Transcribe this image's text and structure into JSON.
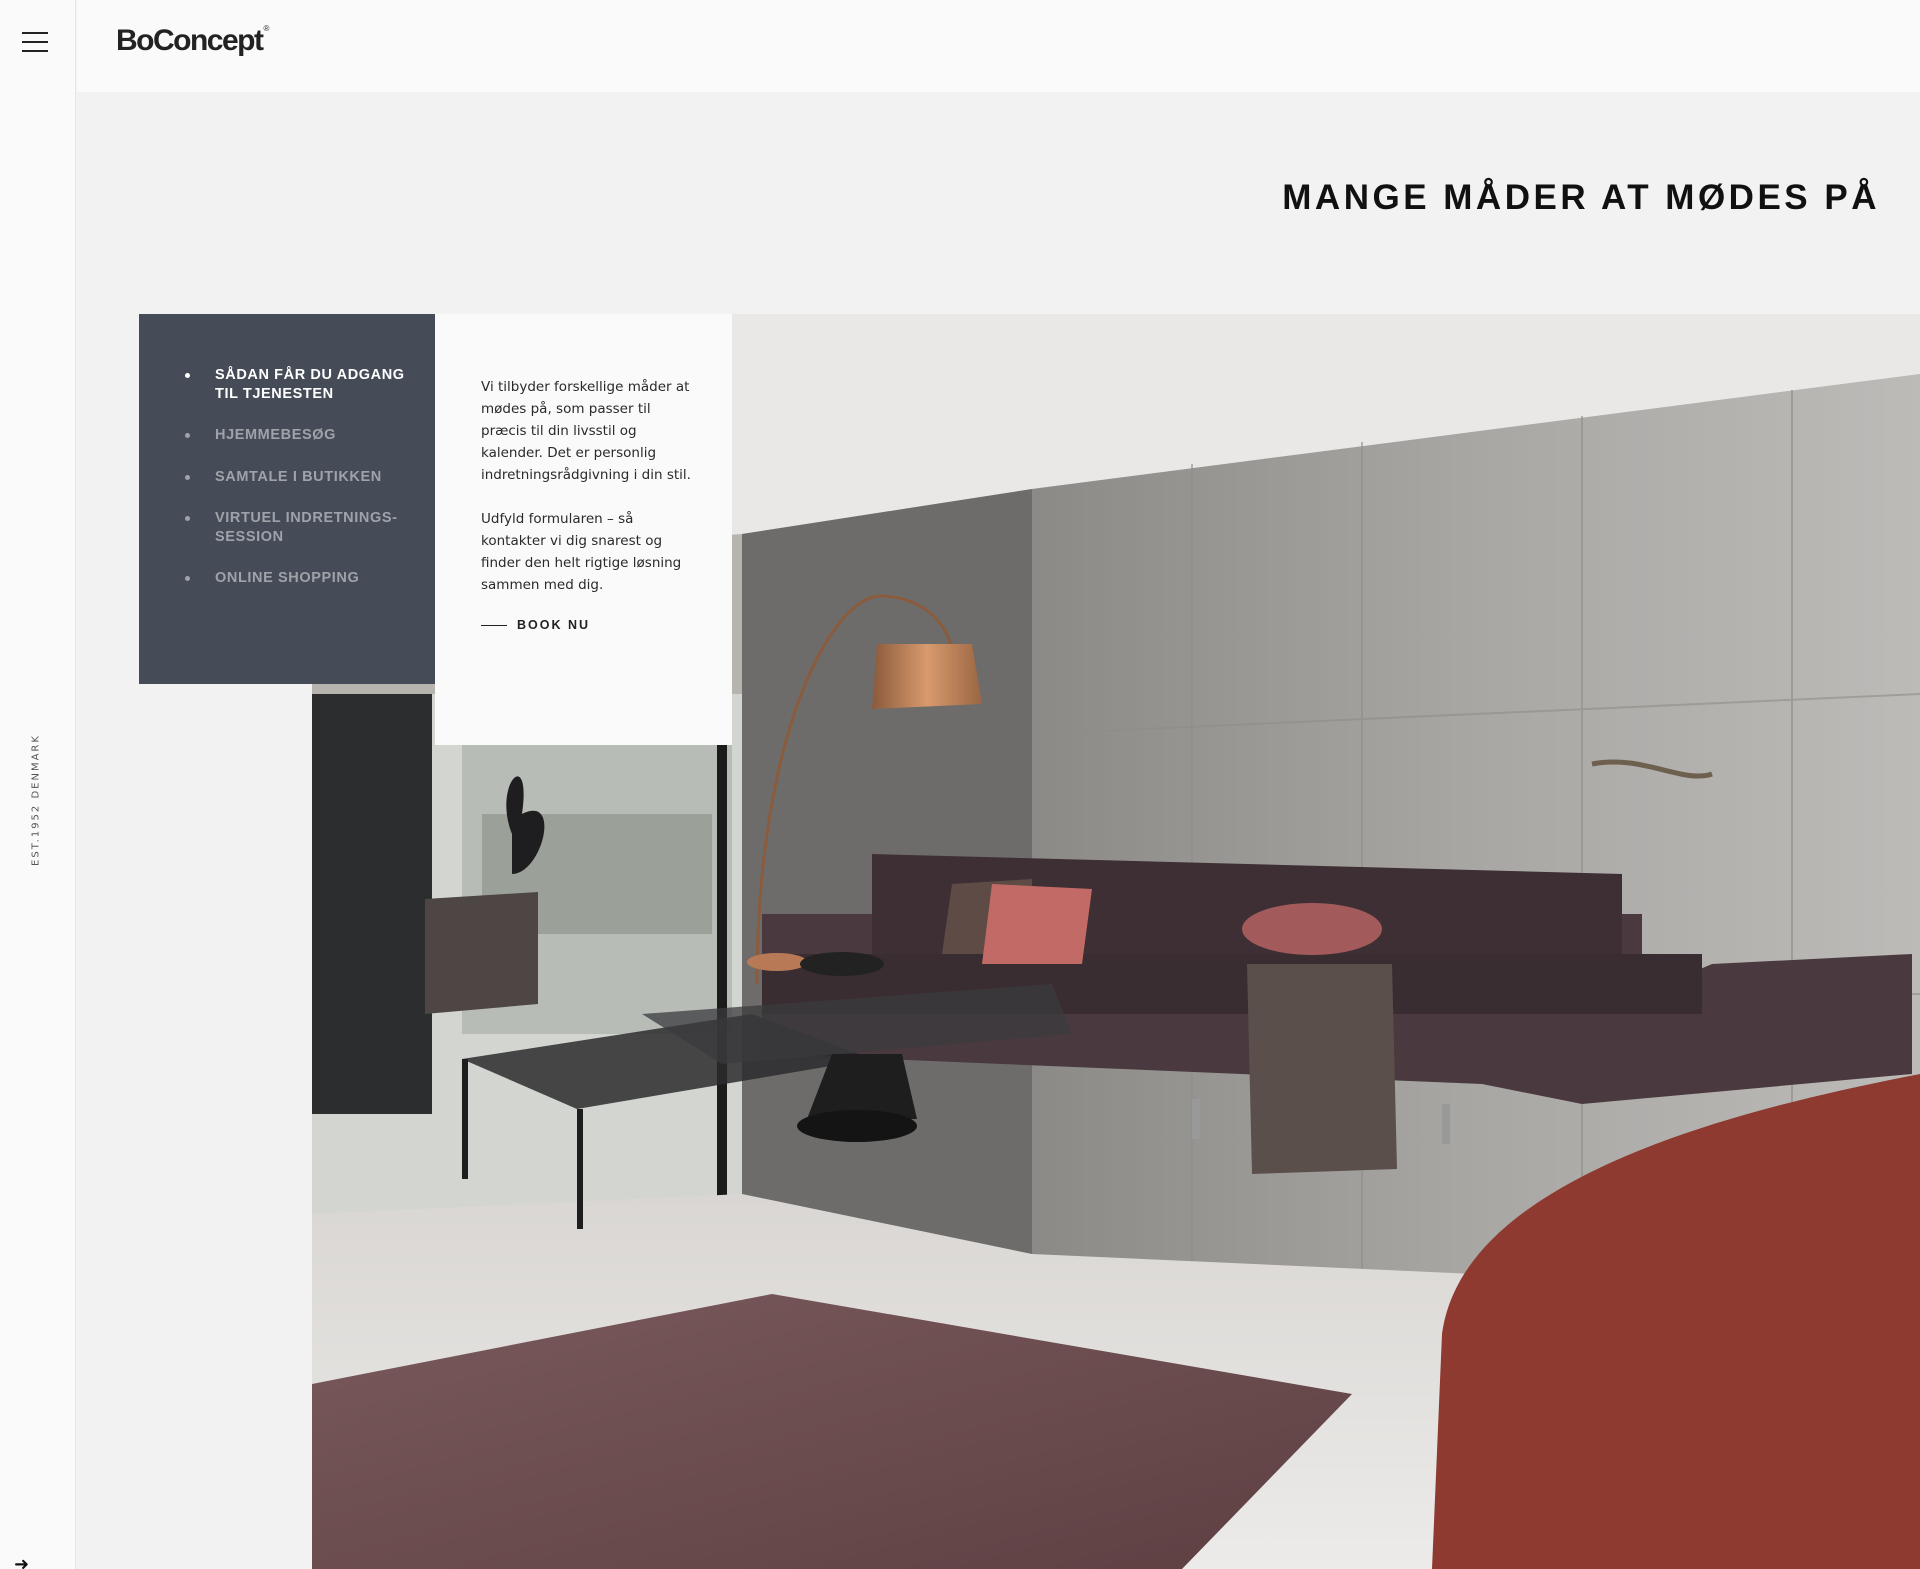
{
  "rail": {
    "menu_icon": "hamburger-menu-icon",
    "est_text": "EST.1952 DENMARK",
    "corner_icon": "arrow-icon"
  },
  "header": {
    "logo": "BoConcept",
    "logo_mark": "®"
  },
  "page_title": "MANGE MÅDER AT MØDES PÅ",
  "nav": {
    "items": [
      {
        "label": "SÅDAN FÅR DU ADGANG TIL TJENESTEN",
        "active": true
      },
      {
        "label": "HJEMMEBESØG",
        "active": false
      },
      {
        "label": "SAMTALE I BUTIKKEN",
        "active": false
      },
      {
        "label": "VIRTUEL INDRETNINGS-SESSION",
        "active": false
      },
      {
        "label": "ONLINE SHOPPING",
        "active": false
      }
    ]
  },
  "card": {
    "paragraph1": "Vi tilbyder forskellige måder at mødes på, som passer til præcis til din livsstil og kalender. Det er personlig indretningsrådgivning i din stil.",
    "paragraph2": "Udfyld formularen – så kontakter vi dig snarest og finder den helt rigtige løsning sammen med dig.",
    "cta": "BOOK NU"
  },
  "hero": {
    "alt_icon": "living-room-photo"
  },
  "colors": {
    "nav_bg": "#454c57",
    "page_bg": "#f2f2f2",
    "header_bg": "#fafafa"
  }
}
